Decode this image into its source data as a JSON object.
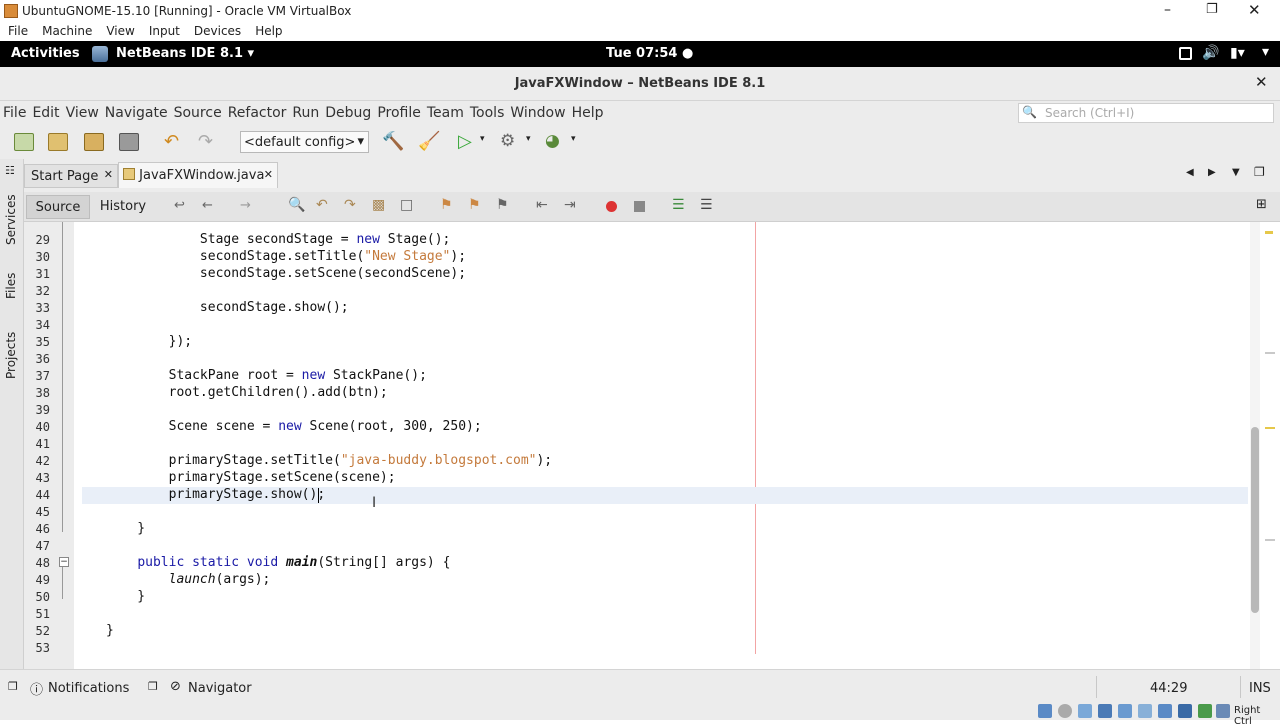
{
  "vbox": {
    "title": "UbuntuGNOME-15.10 [Running] - Oracle VM VirtualBox",
    "menu": [
      "File",
      "Machine",
      "View",
      "Input",
      "Devices",
      "Help"
    ]
  },
  "gnome": {
    "activities": "Activities",
    "app": "NetBeans IDE 8.1 ▾",
    "clock": "Tue 07:54 ●"
  },
  "netbeans": {
    "window_title": "JavaFXWindow – NetBeans IDE 8.1",
    "menu": [
      "File",
      "Edit",
      "View",
      "Navigate",
      "Source",
      "Refactor",
      "Run",
      "Debug",
      "Profile",
      "Team",
      "Tools",
      "Window",
      "Help"
    ],
    "search_placeholder": "Search (Ctrl+I)",
    "config": "<default config>"
  },
  "tabs": [
    {
      "label": "Start Page",
      "active": false
    },
    {
      "label": "JavaFXWindow.java",
      "active": true
    }
  ],
  "editor_tabs": {
    "source": "Source",
    "history": "History"
  },
  "side_panels": [
    "Services",
    "Files",
    "Projects"
  ],
  "code_lines": [
    {
      "n": "29",
      "t": "            Stage secondStage = new Stage();"
    },
    {
      "n": "30",
      "t": "            secondStage.setTitle(\"New Stage\");"
    },
    {
      "n": "31",
      "t": "            secondStage.setScene(secondScene);"
    },
    {
      "n": "32",
      "t": ""
    },
    {
      "n": "33",
      "t": "            secondStage.show();"
    },
    {
      "n": "34",
      "t": ""
    },
    {
      "n": "35",
      "t": "        });"
    },
    {
      "n": "36",
      "t": ""
    },
    {
      "n": "37",
      "t": "        StackPane root = new StackPane();"
    },
    {
      "n": "38",
      "t": "        root.getChildren().add(btn);"
    },
    {
      "n": "39",
      "t": ""
    },
    {
      "n": "40",
      "t": "        Scene scene = new Scene(root, 300, 250);"
    },
    {
      "n": "41",
      "t": ""
    },
    {
      "n": "42",
      "t": "        primaryStage.setTitle(\"java-buddy.blogspot.com\");"
    },
    {
      "n": "43",
      "t": "        primaryStage.setScene(scene);"
    },
    {
      "n": "44",
      "t": "        primaryStage.show();"
    },
    {
      "n": "45",
      "t": ""
    },
    {
      "n": "46",
      "t": "    }"
    },
    {
      "n": "47",
      "t": ""
    },
    {
      "n": "48",
      "t": "    public static void main(String[] args) {"
    },
    {
      "n": "49",
      "t": "        launch(args);"
    },
    {
      "n": "50",
      "t": "    }"
    },
    {
      "n": "51",
      "t": ""
    },
    {
      "n": "52",
      "t": "}"
    },
    {
      "n": "53",
      "t": ""
    }
  ],
  "status": {
    "notifications": "Notifications",
    "navigator": "Navigator",
    "position": "44:29",
    "mode": "INS"
  },
  "vbox_status": {
    "host_key": "Right Ctrl"
  }
}
